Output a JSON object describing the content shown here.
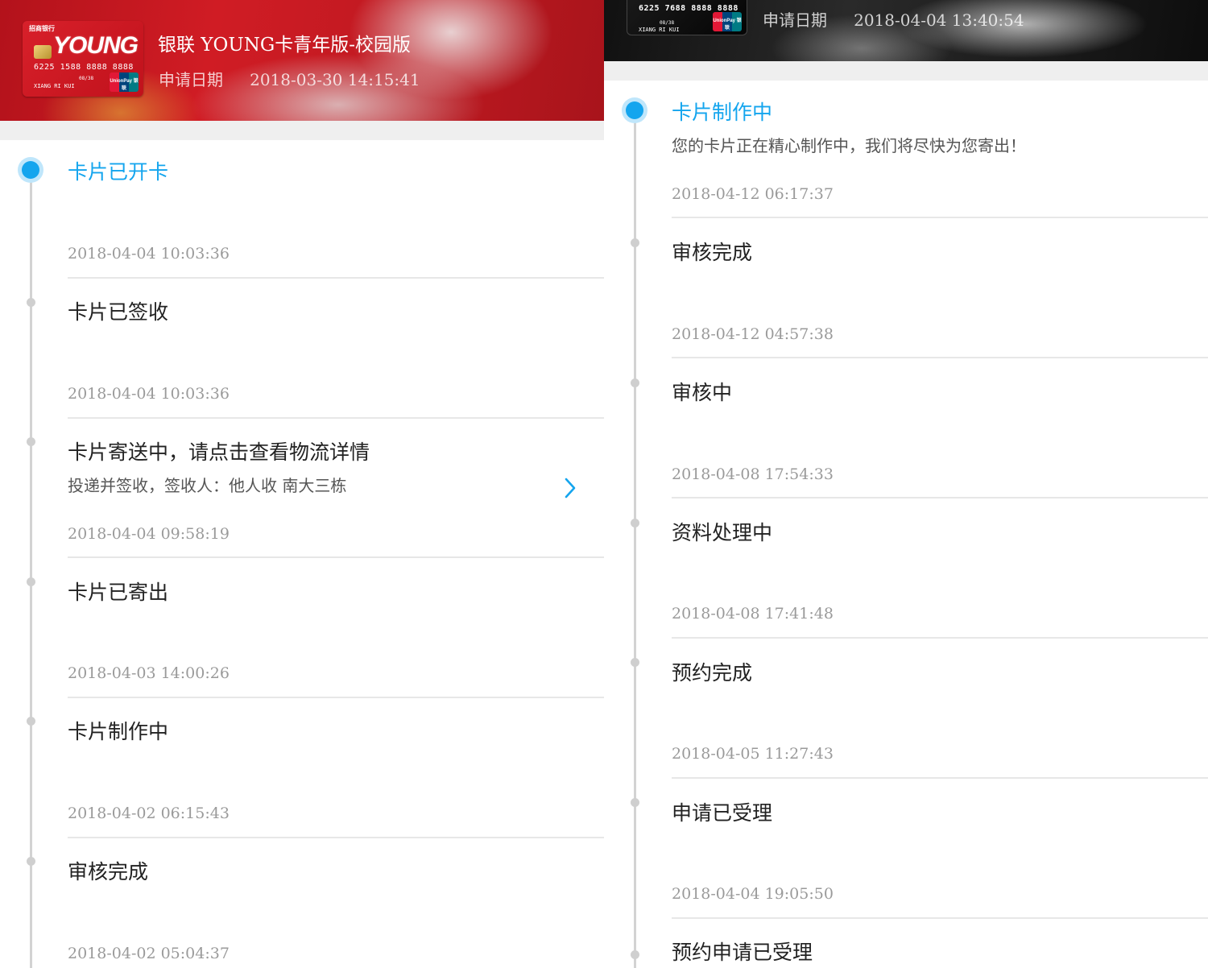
{
  "left": {
    "card": {
      "bank_name": "招商银行",
      "brand": "YOUNG",
      "number": "6225 1588 8888 8888",
      "valid": "08/38",
      "holder": "XIANG RI KUI",
      "network": "UnionPay 银联"
    },
    "header": {
      "title": "银联 YOUNG卡青年版-校园版",
      "date_label": "申请日期",
      "date_value": "2018-03-30 14:15:41"
    },
    "entries": [
      {
        "title": "卡片已开卡",
        "subtitle": "",
        "time": "2018-04-04 10:03:36"
      },
      {
        "title": "卡片已签收",
        "subtitle": "",
        "time": "2018-04-04 10:03:36"
      },
      {
        "title": "卡片寄送中，请点击查看物流详情",
        "subtitle": "投递并签收，签收人：他人收 南大三栋",
        "time": "2018-04-04 09:58:19"
      },
      {
        "title": "卡片已寄出",
        "subtitle": "",
        "time": "2018-04-03 14:00:26"
      },
      {
        "title": "卡片制作中",
        "subtitle": "",
        "time": "2018-04-02 06:15:43"
      },
      {
        "title": "审核完成",
        "subtitle": "",
        "time": "2018-04-02 05:04:37"
      }
    ]
  },
  "right": {
    "card": {
      "number": "6225 7688 8888 8888",
      "valid": "08/38",
      "holder": "XIANG RI KUI",
      "network": "UnionPay 银联"
    },
    "header": {
      "date_label": "申请日期",
      "date_value": "2018-04-04 13:40:54"
    },
    "entries": [
      {
        "title": "卡片制作中",
        "subtitle": "您的卡片正在精心制作中，我们将尽快为您寄出！",
        "time": "2018-04-12 06:17:37"
      },
      {
        "title": "审核完成",
        "subtitle": "",
        "time": "2018-04-12 04:57:38"
      },
      {
        "title": "审核中",
        "subtitle": "",
        "time": "2018-04-08 17:54:33"
      },
      {
        "title": "资料处理中",
        "subtitle": "",
        "time": "2018-04-08 17:41:48"
      },
      {
        "title": "预约完成",
        "subtitle": "",
        "time": "2018-04-05 11:27:43"
      },
      {
        "title": "申请已受理",
        "subtitle": "",
        "time": "2018-04-04 19:05:50"
      },
      {
        "title": "预约申请已受理",
        "subtitle": "",
        "time": ""
      }
    ]
  },
  "colors": {
    "accent": "#14a5ee",
    "timeline": "#d3d3d3",
    "time_text": "#9a9a9a",
    "header_left": "#c31a22",
    "header_right": "#1c1c1c"
  }
}
